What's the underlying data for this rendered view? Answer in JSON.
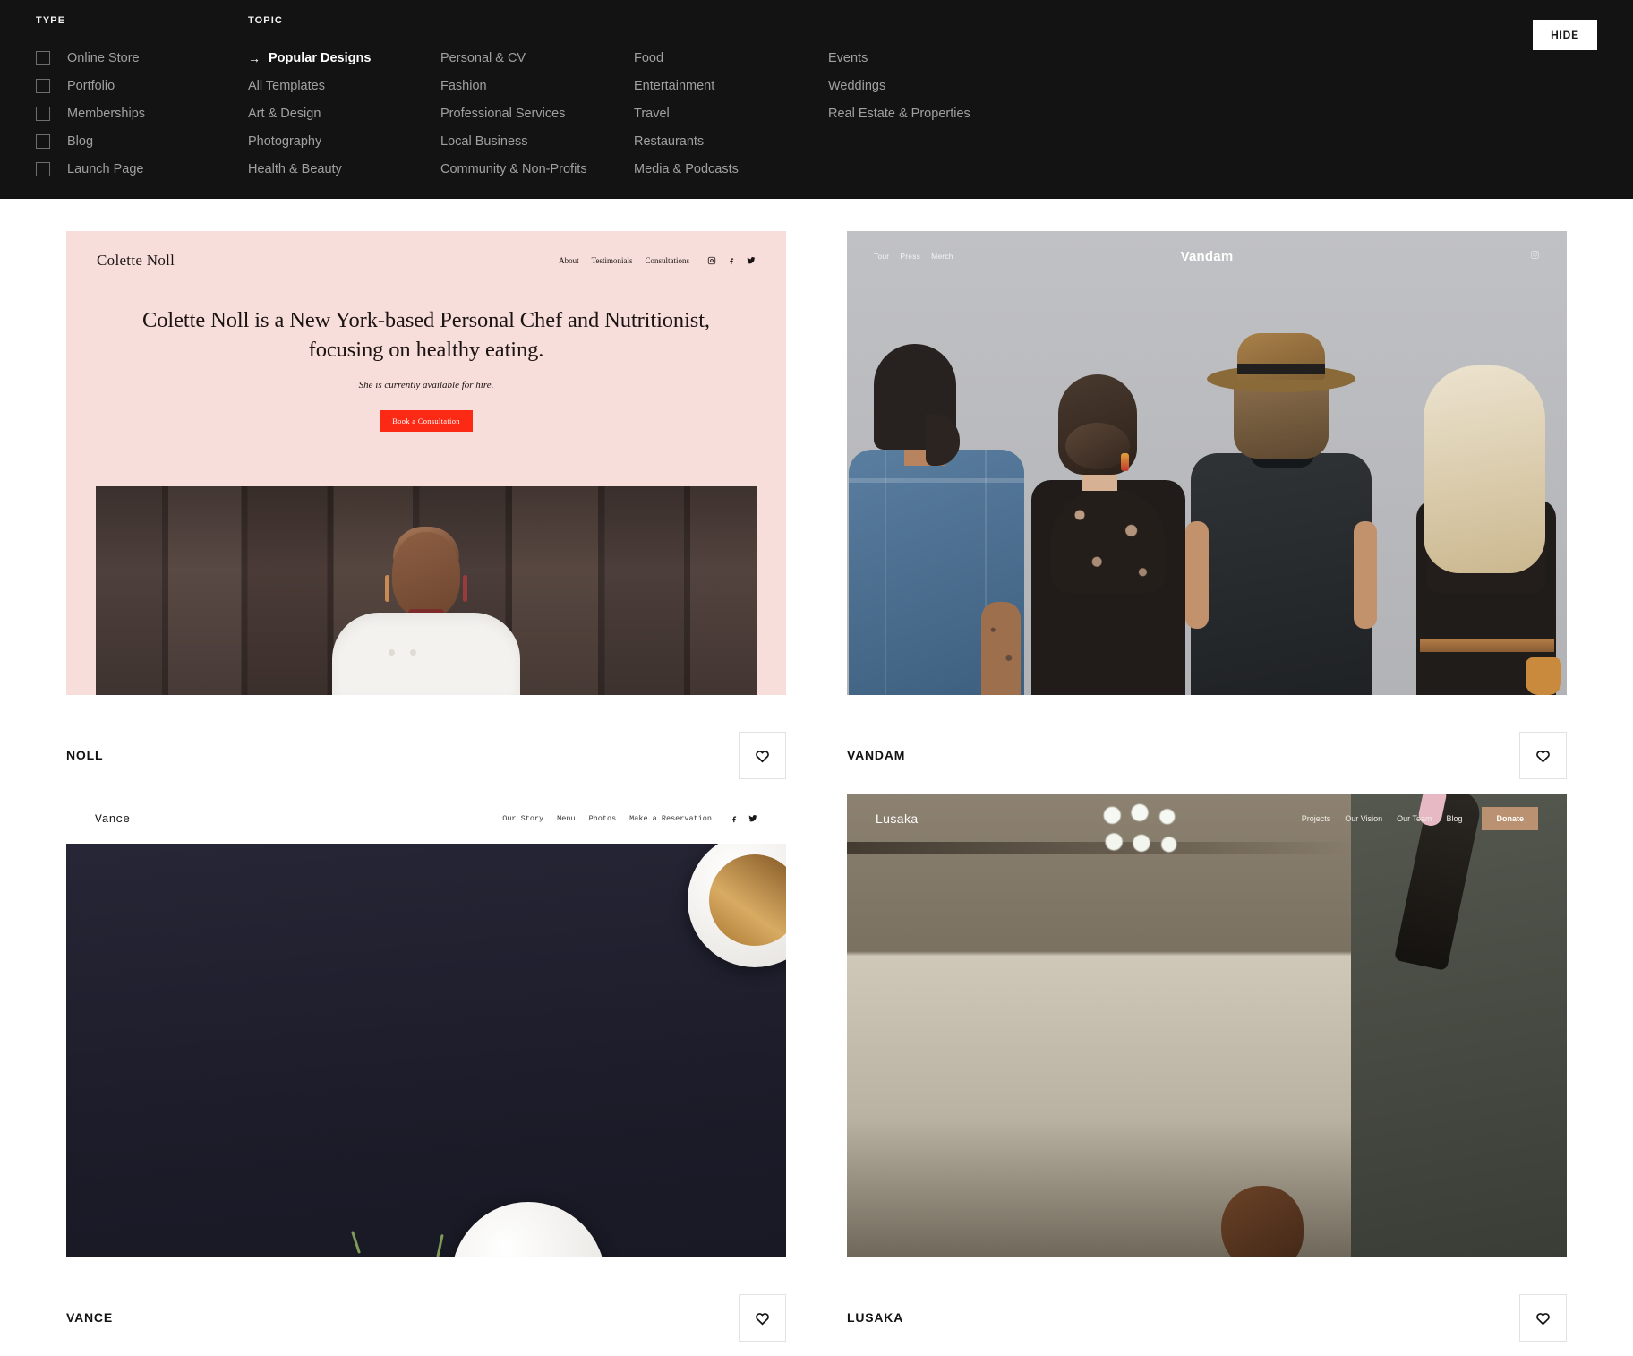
{
  "filter_bar": {
    "type": {
      "label": "TYPE",
      "options": [
        {
          "label": "Online Store",
          "checked": false
        },
        {
          "label": "Portfolio",
          "checked": false
        },
        {
          "label": "Memberships",
          "checked": false
        },
        {
          "label": "Blog",
          "checked": false
        },
        {
          "label": "Launch Page",
          "checked": false
        }
      ]
    },
    "topic": {
      "label": "TOPIC",
      "columns": [
        [
          {
            "label": "Popular Designs",
            "active": true,
            "icon": "arrow-right-icon"
          },
          {
            "label": "All Templates",
            "active": false
          },
          {
            "label": "Art & Design",
            "active": false
          },
          {
            "label": "Photography",
            "active": false
          },
          {
            "label": "Health & Beauty",
            "active": false
          }
        ],
        [
          {
            "label": "Personal & CV",
            "active": false
          },
          {
            "label": "Fashion",
            "active": false
          },
          {
            "label": "Professional Services",
            "active": false
          },
          {
            "label": "Local Business",
            "active": false
          },
          {
            "label": "Community & Non-Profits",
            "active": false
          }
        ],
        [
          {
            "label": "Food",
            "active": false
          },
          {
            "label": "Entertainment",
            "active": false
          },
          {
            "label": "Travel",
            "active": false
          },
          {
            "label": "Restaurants",
            "active": false
          },
          {
            "label": "Media & Podcasts",
            "active": false
          }
        ],
        [
          {
            "label": "Events",
            "active": false
          },
          {
            "label": "Weddings",
            "active": false
          },
          {
            "label": "Real Estate & Properties",
            "active": false
          }
        ]
      ]
    },
    "hide_button": "HIDE",
    "arrow_glyph": "→"
  },
  "colors": {
    "bar_background": "#131313",
    "page_background": "#ffffff",
    "active_text": "#ffffff",
    "inactive_text": "#a0a0a0",
    "noll_accent": "#fc2a15",
    "noll_background": "#f7dedb",
    "lusaka_donate": "#bb9271"
  },
  "templates": [
    {
      "name": "NOLL",
      "favorite_icon": "heart-icon",
      "favorited": false,
      "preview": {
        "logo": "Colette Noll",
        "nav": [
          "About",
          "Testimonials",
          "Consultations"
        ],
        "social": [
          "instagram-icon",
          "facebook-icon",
          "twitter-icon"
        ],
        "headline": "Colette Noll is a New York-based Personal Chef and Nutritionist, focusing on healthy eating.",
        "subhead": "She is currently available for hire.",
        "cta": "Book a Consultation"
      }
    },
    {
      "name": "VANDAM",
      "favorite_icon": "heart-icon",
      "favorited": false,
      "preview": {
        "logo": "Vandam",
        "nav": [
          "Tour",
          "Press",
          "Merch"
        ],
        "social": [
          "instagram-icon"
        ]
      }
    },
    {
      "name": "VANCE",
      "favorite_icon": "heart-icon",
      "favorited": false,
      "preview": {
        "logo": "Vance",
        "nav": [
          "Our Story",
          "Menu",
          "Photos",
          "Make a Reservation"
        ],
        "social": [
          "facebook-icon",
          "twitter-icon"
        ]
      }
    },
    {
      "name": "LUSAKA",
      "favorite_icon": "heart-icon",
      "favorited": false,
      "preview": {
        "logo": "Lusaka",
        "nav": [
          "Projects",
          "Our Vision",
          "Our Team",
          "Blog"
        ],
        "cta": "Donate"
      }
    }
  ]
}
